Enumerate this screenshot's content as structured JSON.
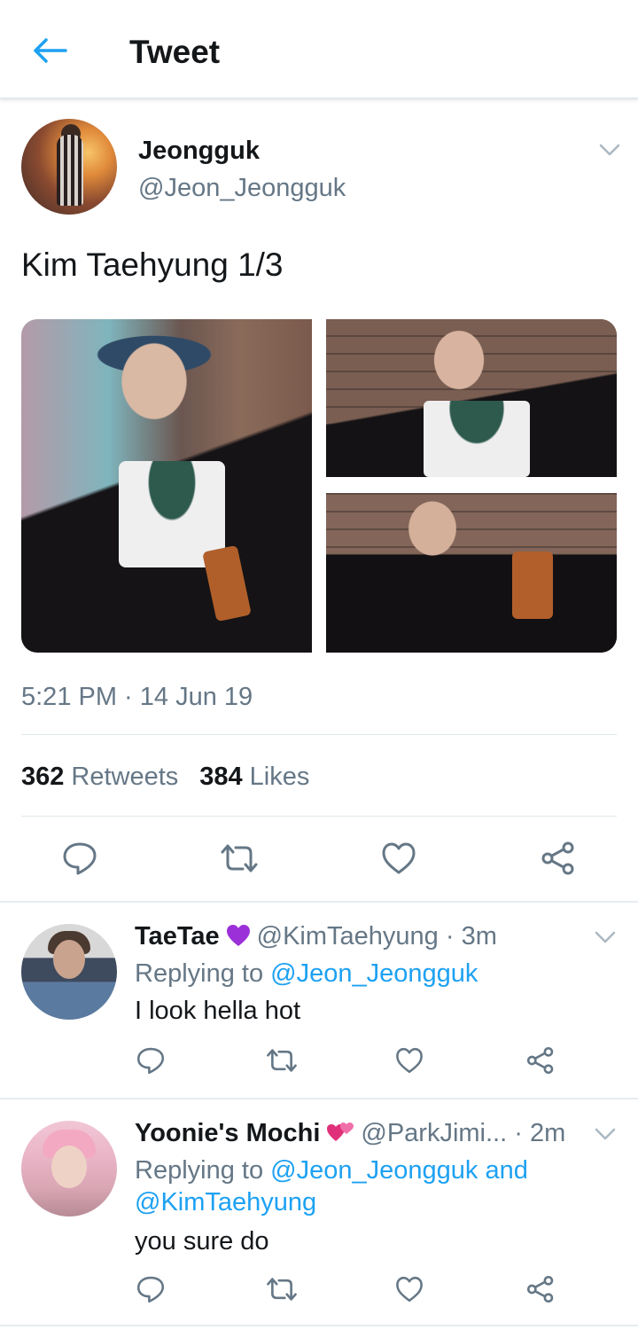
{
  "header": {
    "title": "Tweet",
    "back_icon": "arrow-left-icon"
  },
  "colors": {
    "accent": "#1da1f2",
    "text": "#14171a",
    "secondary": "#657786",
    "divider": "#e1e8ed"
  },
  "tweet": {
    "author_name": "Jeongguk",
    "author_handle": "@Jeon_Jeongguk",
    "text": "Kim Taehyung 1/3",
    "images": [
      {
        "alt": "Photo 1"
      },
      {
        "alt": "Photo 2"
      },
      {
        "alt": "Photo 3"
      }
    ],
    "timestamp": "5:21 PM · 14 Jun 19",
    "retweets_count": "362",
    "retweets_label": "Retweets",
    "likes_count": "384",
    "likes_label": "Likes"
  },
  "replies": [
    {
      "name": "TaeTae",
      "emoji": "purple-heart",
      "handle": "@KimTaehyung",
      "time": "· 3m",
      "replying_prefix": "Replying to",
      "replying_to_1": "@Jeon_Jeongguk",
      "replying_joiner": "",
      "replying_to_2": "",
      "text": "I look hella hot"
    },
    {
      "name": "Yoonie's Mochi",
      "emoji": "two-hearts",
      "handle": "@ParkJimi...",
      "time": "· 2m",
      "replying_prefix": "Replying to",
      "replying_to_1": "@Jeon_Jeongguk",
      "replying_joiner": "and",
      "replying_to_2": "@KimTaehyung",
      "text": "you sure do"
    }
  ]
}
